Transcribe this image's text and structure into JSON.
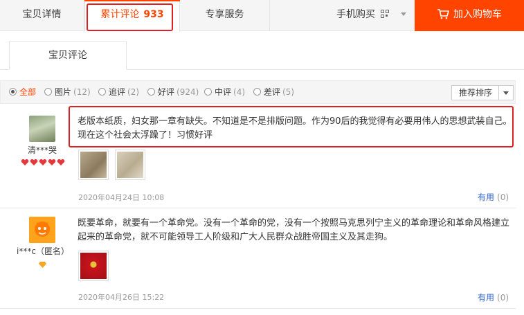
{
  "tabs": {
    "detail": "宝贝详情",
    "reviews_label": "累计评论",
    "reviews_count": "933",
    "service": "专享服务",
    "mobile": "手机购买",
    "cart": "加入购物车"
  },
  "subtab": "宝贝评论",
  "filters": {
    "all": "全部",
    "pics": {
      "label": "图片",
      "count": "(12)"
    },
    "followup": {
      "label": "追评",
      "count": "(2)"
    },
    "good": {
      "label": "好评",
      "count": "(924)"
    },
    "neutral": {
      "label": "中评",
      "count": "(4)"
    },
    "bad": {
      "label": "差评",
      "count": "(5)"
    },
    "sort": "推荐排序"
  },
  "reviews": [
    {
      "user": "清***哭",
      "text": "老版本纸质，妇女那一章有缺失。不知道是不是排版问题。作为90后的我觉得有必要用伟人的思想武装自己。现在这个社会太浮躁了！习惯好评",
      "date": "2020年04月24日 10:08",
      "useful_label": "有用",
      "useful_count": "(0)",
      "image_count": 2
    },
    {
      "user": "i***c（匿名）",
      "text": "既要革命，就要有一个革命党。没有一个革命的党，没有一个按照马克思列宁主义的革命理论和革命风格建立起来的革命党，就不可能领导工人阶级和广大人民群众战胜帝国主义及其走狗。",
      "date": "2020年04月26日 15:22",
      "useful_label": "有用",
      "useful_count": "(0)",
      "image_count": 1
    }
  ],
  "colors": {
    "accent": "#ff4400",
    "highlight": "#e02020",
    "link": "#3366cc"
  }
}
